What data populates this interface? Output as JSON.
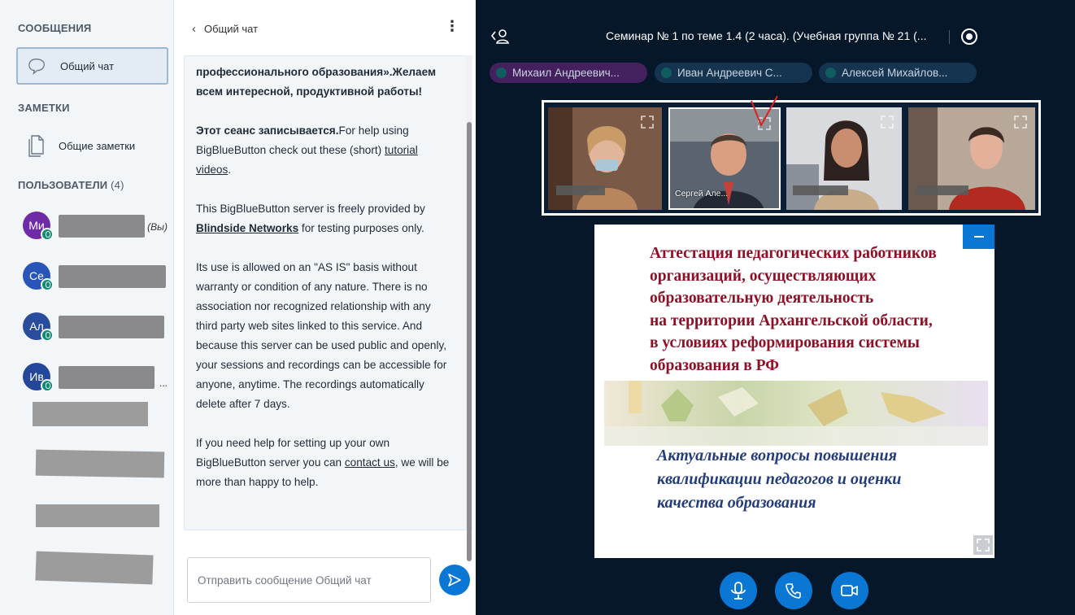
{
  "sidebar": {
    "messages_title": "СООБЩЕНИЯ",
    "public_chat_label": "Общий чат",
    "notes_title": "ЗАМЕТКИ",
    "shared_notes_label": "Общие заметки",
    "users_title": "ПОЛЬЗОВАТЕЛИ",
    "users_count": "(4)",
    "users": [
      {
        "initials": "Ми",
        "color": "#6f2aa7",
        "suffix": "(Вы)",
        "name_hidden": true
      },
      {
        "initials": "Се",
        "color": "#2954b8",
        "suffix": "",
        "name_hidden": true
      },
      {
        "initials": "Ал",
        "color": "#2a4c9c",
        "suffix": "",
        "name_hidden": true
      },
      {
        "initials": "Ив",
        "color": "#25479a",
        "suffix": "...",
        "name_hidden": true
      }
    ]
  },
  "chat": {
    "back_label": "Общий чат",
    "menu_icon": "kebab-icon",
    "intro_fragment": "профессионального образования».Желаем всем интересной, продуктивной работы!",
    "recording_bold": "Этот сеанс записывается.",
    "help_text": "For help using BigBlueButton check out these (short) ",
    "tutorial_link": "tutorial videos",
    "help_end": ".",
    "server_text_1": "This BigBlueButton server is freely provided by ",
    "blindside_link": "Blindside Networks",
    "server_text_2": " for testing purposes only.",
    "as_is_text": "Its use is allowed on an \"AS IS\" basis without warranty or condition of any nature. There is no association nor recognized relationship with any third party web sites linked to this service. And because this server can be used public and openly, your sessions and recordings can be accessible for anyone, anytime. The recordings automatically delete after 7 days.",
    "setup_text_1": "If you need help for setting up your own BigBlueButton server you can ",
    "contact_link": "contact us",
    "setup_text_2": ", we will be more than happy to help.",
    "input_placeholder": "Отправить сообщение Общий чат"
  },
  "meeting": {
    "title": "Семинар № 1 по теме 1.4 (2 часа). (Учебная группа № 21 (...",
    "talkers": [
      "Михаил Андреевич...",
      "Иван Андреевич С...",
      "Алексей Михайлов..."
    ],
    "video_tiles": [
      {
        "name": "",
        "highlight": false
      },
      {
        "name": "Сергей Але...",
        "highlight": true
      },
      {
        "name": "",
        "highlight": false
      },
      {
        "name": "",
        "highlight": false
      }
    ],
    "slide": {
      "heading": "Аттестация педагогических работников\nорганизаций, осуществляющих\nобразовательную деятельность\nна территории Архангельской области,\nв условиях реформирования системы\nобразования в РФ",
      "subheading": "Актуальные вопросы повышения\nквалификации педагогов и оценки\nкачества образования"
    },
    "controls": [
      "microphone-icon",
      "phone-icon",
      "camera-icon"
    ],
    "accent_color": "#0b77d4",
    "background_color": "#06172a"
  }
}
